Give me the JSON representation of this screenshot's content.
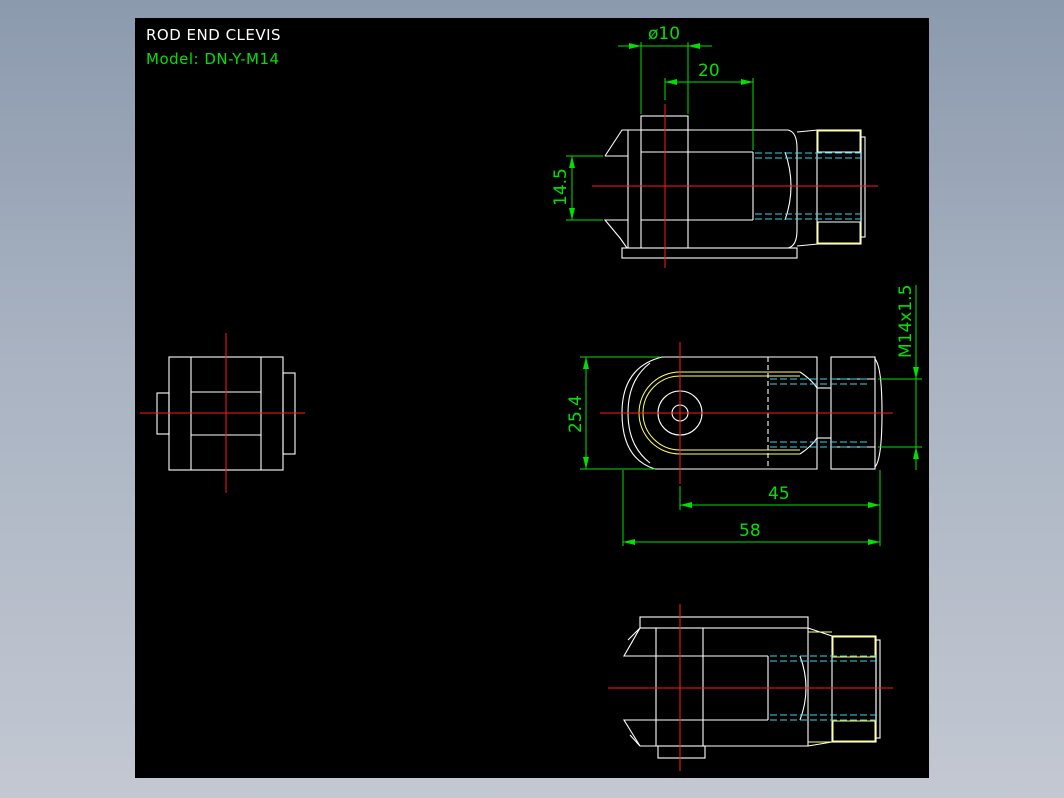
{
  "drawing": {
    "title": "ROD END CLEVIS",
    "model": "Model: DN-Y-M14"
  },
  "dimensions": {
    "pin_diameter": "ø10",
    "top_width": "20",
    "slot_width": "14.5",
    "body_height": "25.4",
    "thread": "M14x1.5",
    "pin_to_end": "45",
    "overall_length": "58"
  },
  "colors": {
    "background": "#000000",
    "outline": "#ffffff",
    "centerline": "#ff1a1a",
    "hidden_line": "#33d6e6",
    "dimension": "#00e000",
    "highlight": "#ffff66"
  }
}
